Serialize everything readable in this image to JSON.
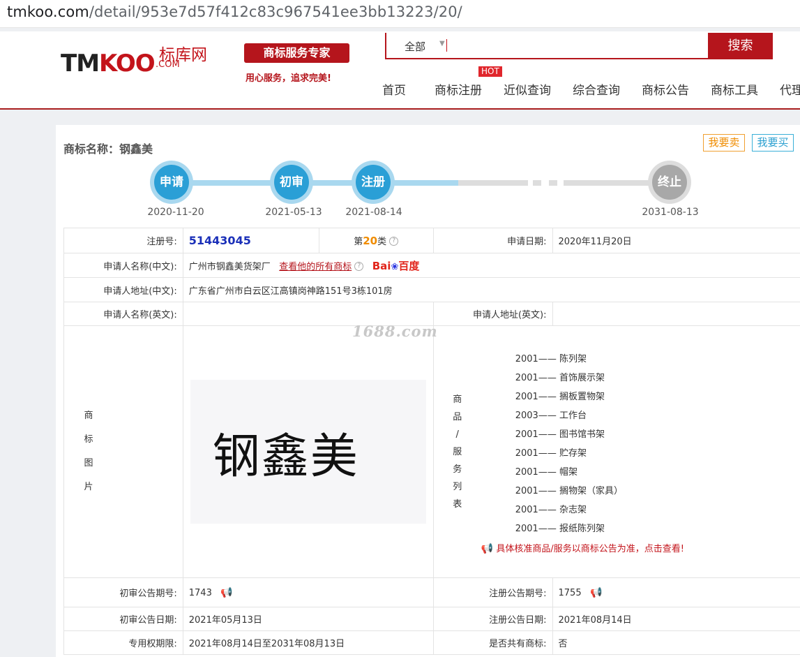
{
  "browser": {
    "url_domain": "tmkoo.com",
    "url_path": "/detail/953e7d57f412c83c967541ee3bb13223/20/"
  },
  "header": {
    "logo_tm": "TM",
    "logo_koo": "KOO",
    "logo_cn": "标库网",
    "logo_com": ".COM",
    "slogan": "商标服务专家",
    "slogan_sub": "用心服务，追求完美!",
    "search_scope": "全部",
    "search_placeholder": "",
    "search_button": "搜索",
    "hot_badge": "HOT",
    "nav": [
      "首页",
      "商标注册",
      "近似查询",
      "综合查询",
      "商标公告",
      "商标工具",
      "代理"
    ]
  },
  "card": {
    "name_label": "商标名称：",
    "name_value": "钢鑫美",
    "sell_button": "我要卖",
    "buy_button": "我要买"
  },
  "timeline": {
    "nodes": [
      {
        "label": "申请",
        "date": "2020-11-20"
      },
      {
        "label": "初审",
        "date": "2021-05-13"
      },
      {
        "label": "注册",
        "date": "2021-08-14"
      },
      {
        "label": "终止",
        "date": "2031-08-13"
      }
    ]
  },
  "detail": {
    "reg_no_label": "注册号:",
    "reg_no": "51443045",
    "class_prefix": "第",
    "class_num": "20",
    "class_suffix": "类",
    "apply_date_label": "申请日期:",
    "apply_date": "2020年11月20日",
    "applicant_cn_label": "申请人名称(中文):",
    "applicant_cn": "广州市钢鑫美货架厂",
    "view_all_link": "查看他的所有商标",
    "baidu_bai": "Bai",
    "baidu_du": "百度",
    "address_cn_label": "申请人地址(中文):",
    "address_cn": "广东省广州市白云区江高镇岗神路151号3栋101房",
    "applicant_en_label": "申请人名称(英文):",
    "applicant_en": "",
    "address_en_label": "申请人地址(英文):",
    "address_en": "",
    "image_label_chars": [
      "商",
      "标",
      "图",
      "片"
    ],
    "image_text": "钢鑫美",
    "goods_label_chars": [
      "商",
      "品",
      "/",
      "服",
      "务",
      "列",
      "表"
    ],
    "goods": [
      "2001—— 陈列架",
      "2001—— 首饰展示架",
      "2001—— 搁板置物架",
      "2003—— 工作台",
      "2001—— 图书馆书架",
      "2001—— 贮存架",
      "2001—— 帽架",
      "2001—— 搁物架（家具）",
      "2001—— 杂志架",
      "2001—— 报纸陈列架"
    ],
    "goods_note": "具体核准商品/服务以商标公告为准，点击查看!",
    "watermark": "1688.com",
    "prelim_no_label": "初审公告期号:",
    "prelim_no": "1743",
    "reg_pub_no_label": "注册公告期号:",
    "reg_pub_no": "1755",
    "prelim_date_label": "初审公告日期:",
    "prelim_date": "2021年05月13日",
    "reg_pub_date_label": "注册公告日期:",
    "reg_pub_date": "2021年08月14日",
    "exclusive_label": "专用权期限:",
    "exclusive": "2021年08月14日至2031年08月13日",
    "shared_label": "是否共有商标:",
    "shared": "否"
  }
}
